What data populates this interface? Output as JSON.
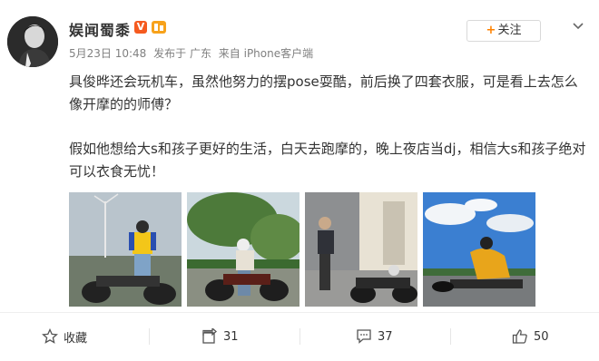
{
  "post": {
    "user_name": "娱闻蜀黍",
    "vip_label": "V",
    "timestamp": "5月23日 10:48",
    "location": "发布于 广东",
    "source": "来自 iPhone客户端",
    "follow_label": "关注",
    "paragraph1": "具俊晔还会玩机车，虽然他努力的摆pose耍酷，前后换了四套衣服，可是看上去怎么像开摩的的师傅？",
    "paragraph2": "假如他想给大s和孩子更好的生活，白天去跑摩的，晚上夜店当dj，相信大s和孩子绝对可以衣食无忧！"
  },
  "actions": {
    "favorite_label": "收藏",
    "repost_count": "31",
    "comment_count": "37",
    "like_count": "50"
  },
  "colors": {
    "follow_plus": "#ff8200",
    "vip_badge": "#f55a1f"
  },
  "icons": [
    "avatar",
    "vip-badge-icon",
    "level-badge-icon",
    "more-chevron-icon",
    "star-icon",
    "repost-icon",
    "comment-icon",
    "thumbs-up-icon"
  ]
}
